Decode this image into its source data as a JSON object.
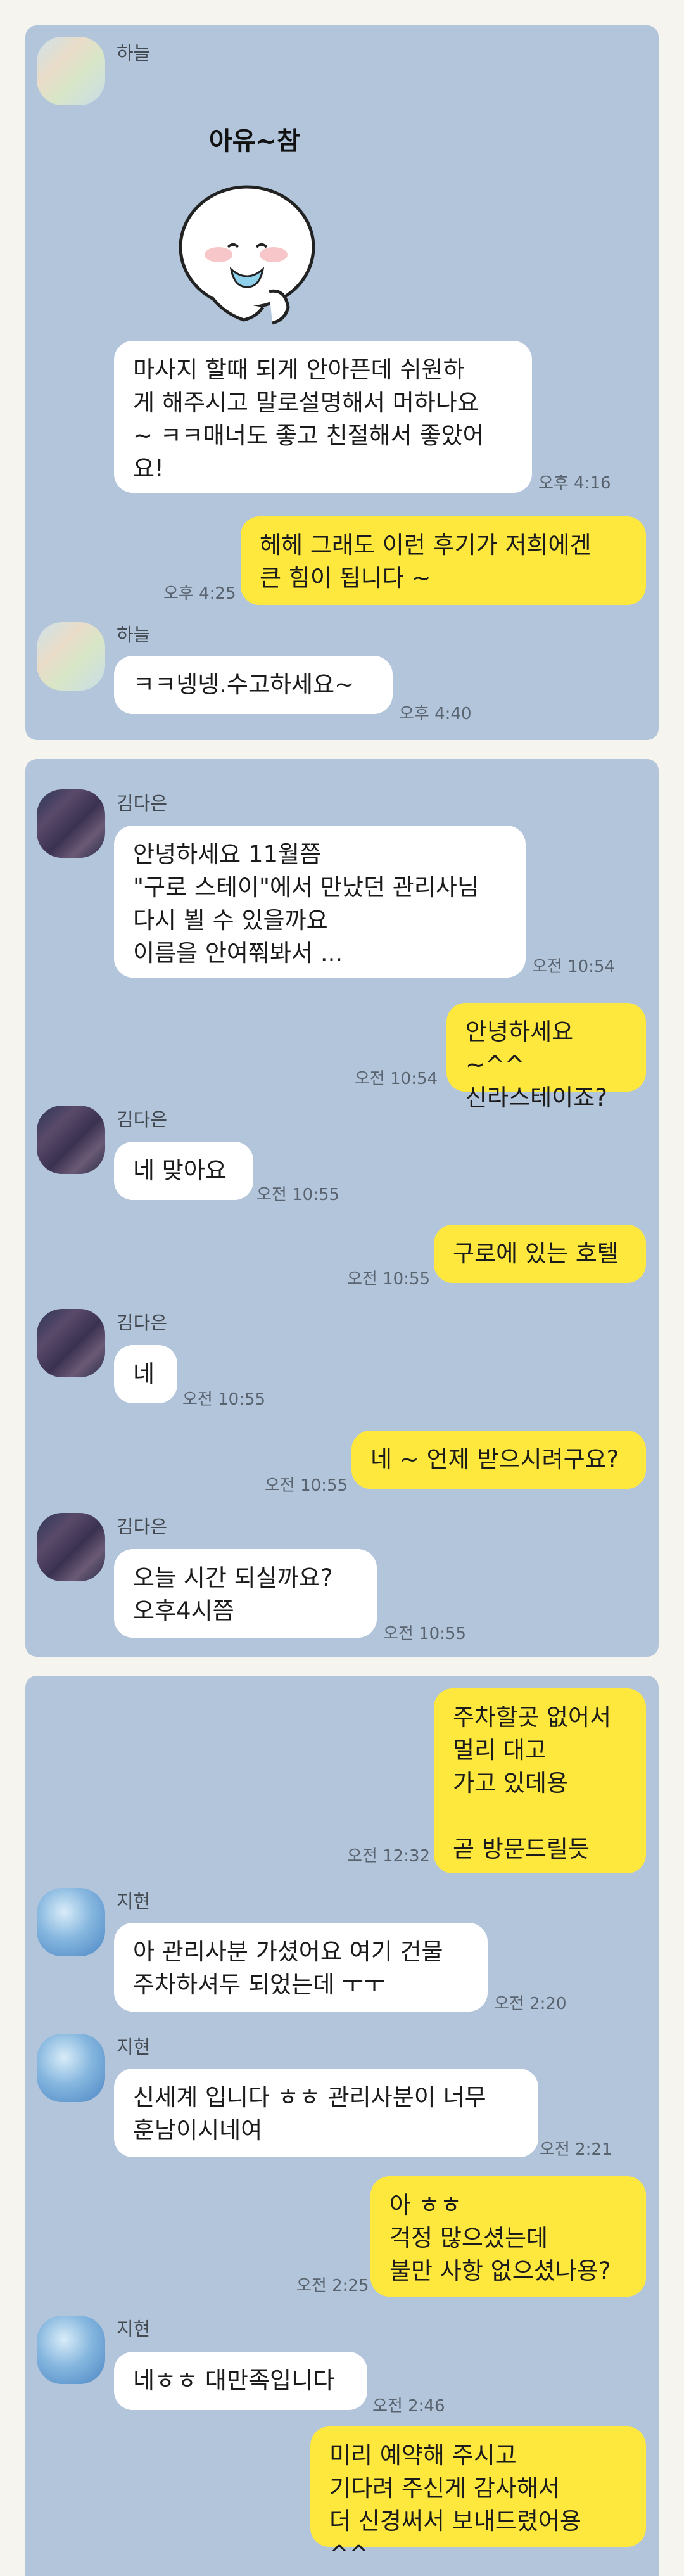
{
  "panel1": {
    "sticker_text": "아유~참",
    "msgs": [
      {
        "name": "하늘",
        "text": "마사지 할때 되게 안아픈데 쉬원하\n게 해주시고 말로설명해서 머하나요\n~ ㅋㅋ매너도 좋고 친절해서 좋았어\n요!",
        "time": "오후 4:16"
      },
      {
        "text": "헤헤 그래도 이런 후기가 저희에겐\n큰 힘이 됩니다 ~",
        "time": "오후 4:25"
      },
      {
        "name": "하늘",
        "text": "ㅋㅋ넹넹.수고하세요~",
        "time": "오후 4:40"
      }
    ]
  },
  "panel2": {
    "msgs": [
      {
        "name": "김다은",
        "text": "안녕하세요 11월쯤\n\"구로 스테이\"에서 만났던 관리사님\n다시 뵐 수 있을까요\n이름을 안여쭤봐서 ...",
        "time": "오전 10:54"
      },
      {
        "text": "안녕하세요 ~^^\n신라스테이죠?",
        "time": "오전 10:54"
      },
      {
        "name": "김다은",
        "text": "네 맞아요",
        "time": "오전 10:55"
      },
      {
        "text": "구로에 있는 호텔",
        "time": "오전 10:55"
      },
      {
        "name": "김다은",
        "text": "네",
        "time": "오전 10:55"
      },
      {
        "text": "네 ~ 언제 받으시려구요?",
        "time": "오전 10:55"
      },
      {
        "name": "김다은",
        "text": "오늘 시간 되실까요?\n오후4시쯤",
        "time": "오전 10:55"
      }
    ]
  },
  "panel3": {
    "msgs": [
      {
        "text": "주차할곳 없어서\n멀리 대고\n가고 있데용\n\n곧 방문드릴듯",
        "time": "오전 12:32"
      },
      {
        "name": "지현",
        "text": "아 관리사분 가셨어요 여기 건물\n주차하셔두 되었는데 ㅜㅜ",
        "time": "오전 2:20"
      },
      {
        "name": "지현",
        "text": "신세계 입니다 ㅎㅎ 관리사분이 너무\n훈남이시네여",
        "time": "오전 2:21"
      },
      {
        "text": "아 ㅎㅎ\n걱정 많으셨는데\n불만 사항 없으셨나용?",
        "time": "오전 2:25"
      },
      {
        "name": "지현",
        "text": "네ㅎㅎ 대만족입니다",
        "time": "오전 2:46"
      },
      {
        "text": "미리 예약해 주시고\n기다려 주신게 감사해서\n더 신경써서 보내드렸어용 ^^",
        "time": ""
      }
    ]
  }
}
